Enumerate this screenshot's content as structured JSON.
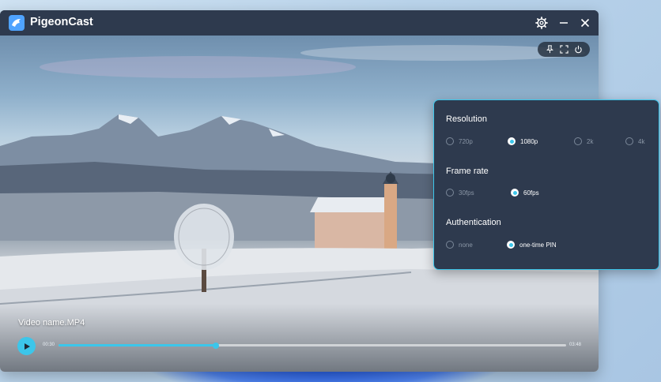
{
  "app": {
    "title": "PigeonCast",
    "icons": {
      "logo": "bird-logo-icon",
      "settings": "gear-icon",
      "minimize": "minimize-icon",
      "close": "close-icon"
    }
  },
  "overlay": {
    "icons": [
      "pin-icon",
      "fullscreen-icon",
      "power-icon"
    ]
  },
  "player": {
    "video_name": "Video name.MP4",
    "current_time": "00:30",
    "total_time": "03:48",
    "progress": 0.31
  },
  "settings": {
    "resolution": {
      "title": "Resolution",
      "options": [
        "720p",
        "1080p",
        "2k",
        "4k"
      ],
      "selected": "1080p"
    },
    "frame_rate": {
      "title": "Frame rate",
      "options": [
        "30fps",
        "60fps"
      ],
      "selected": "60fps"
    },
    "authentication": {
      "title": "Authentication",
      "options": [
        "none",
        "one-time PIN"
      ],
      "selected": "one-time PIN"
    }
  },
  "colors": {
    "accent": "#3cc6ea",
    "panel": "#2e3a4e",
    "titlebar": "#2e3a4e"
  }
}
